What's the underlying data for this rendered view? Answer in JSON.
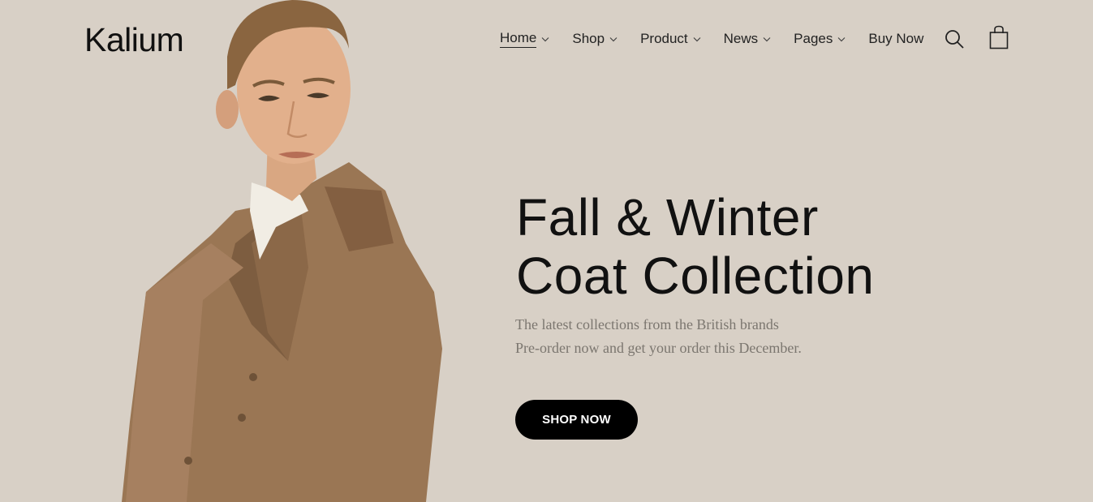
{
  "brand": {
    "logo_text": "Kalium"
  },
  "nav": {
    "items": [
      {
        "label": "Home",
        "active": true,
        "has_dropdown": true
      },
      {
        "label": "Shop",
        "active": false,
        "has_dropdown": true
      },
      {
        "label": "Product",
        "active": false,
        "has_dropdown": true
      },
      {
        "label": "News",
        "active": false,
        "has_dropdown": true
      },
      {
        "label": "Pages",
        "active": false,
        "has_dropdown": true
      },
      {
        "label": "Buy Now",
        "active": false,
        "has_dropdown": false
      }
    ],
    "search_icon": "search-icon",
    "cart_icon": "shopping-bag-icon"
  },
  "hero": {
    "title_line1": "Fall & Winter",
    "title_line2": "Coat Collection",
    "subtitle_line1": "The latest collections from the British brands",
    "subtitle_line2": "Pre-order now and get your order this December.",
    "cta_label": "SHOP NOW",
    "background_color": "#d8d0c6",
    "coat_color": "#9a7654"
  }
}
